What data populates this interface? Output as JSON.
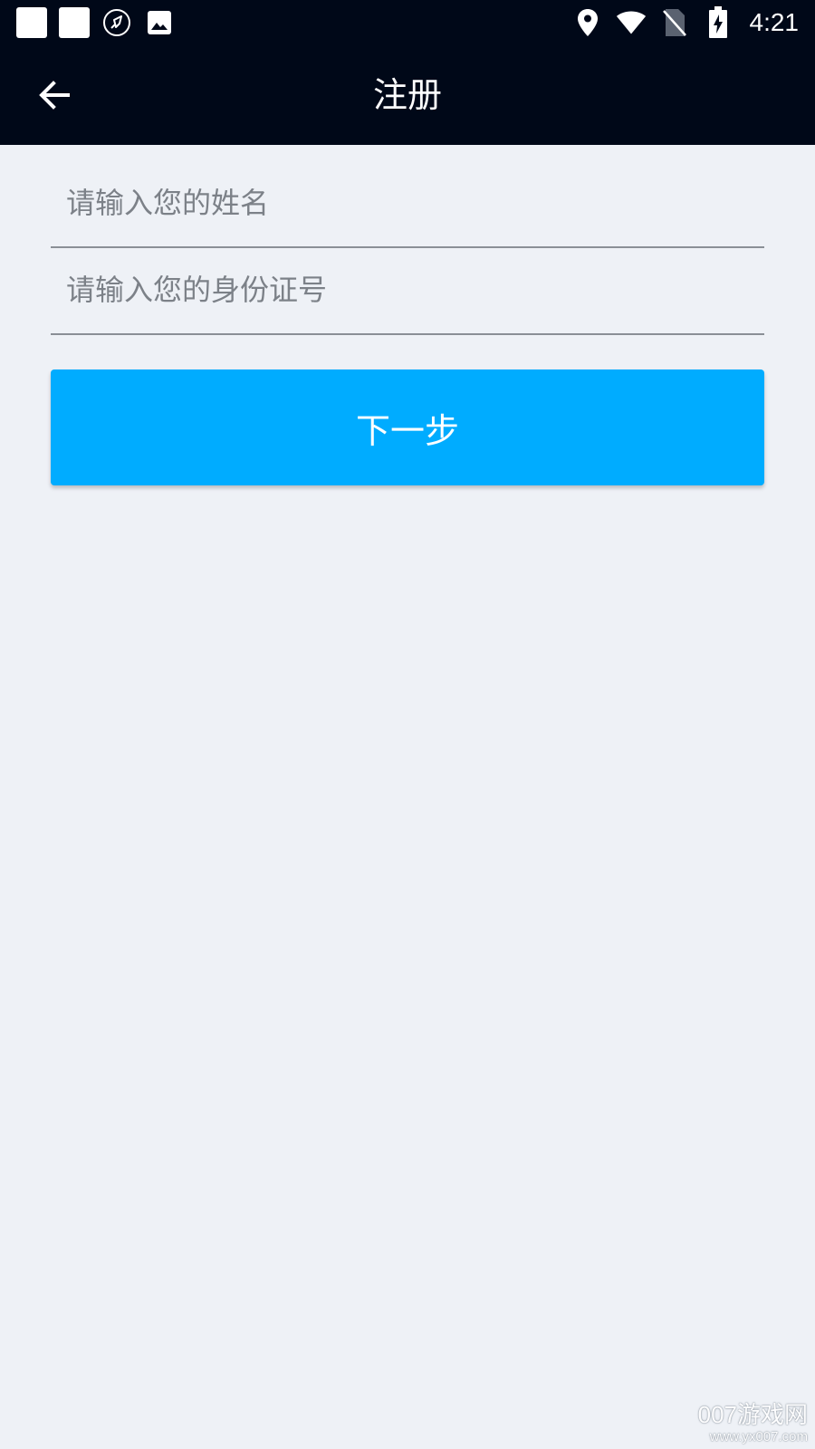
{
  "status_bar": {
    "time": "4:21",
    "left_icons": [
      "notification-square-icon",
      "notification-square-icon",
      "rocket-icon",
      "image-icon"
    ],
    "right_icons": [
      "location-pin-icon",
      "wifi-icon",
      "no-sim-icon",
      "battery-charging-icon"
    ]
  },
  "app_bar": {
    "title": "注册",
    "back_icon": "arrow-back-icon"
  },
  "form": {
    "name_placeholder": "请输入您的姓名",
    "name_value": "",
    "id_placeholder": "请输入您的身份证号",
    "id_value": "",
    "next_label": "下一步"
  },
  "watermark": {
    "main": "007游戏网",
    "url": "www.yx007.com"
  },
  "colors": {
    "bar_background": "#000818",
    "page_background": "#eef1f6",
    "accent": "#00acff",
    "divider": "#8a8f96"
  }
}
